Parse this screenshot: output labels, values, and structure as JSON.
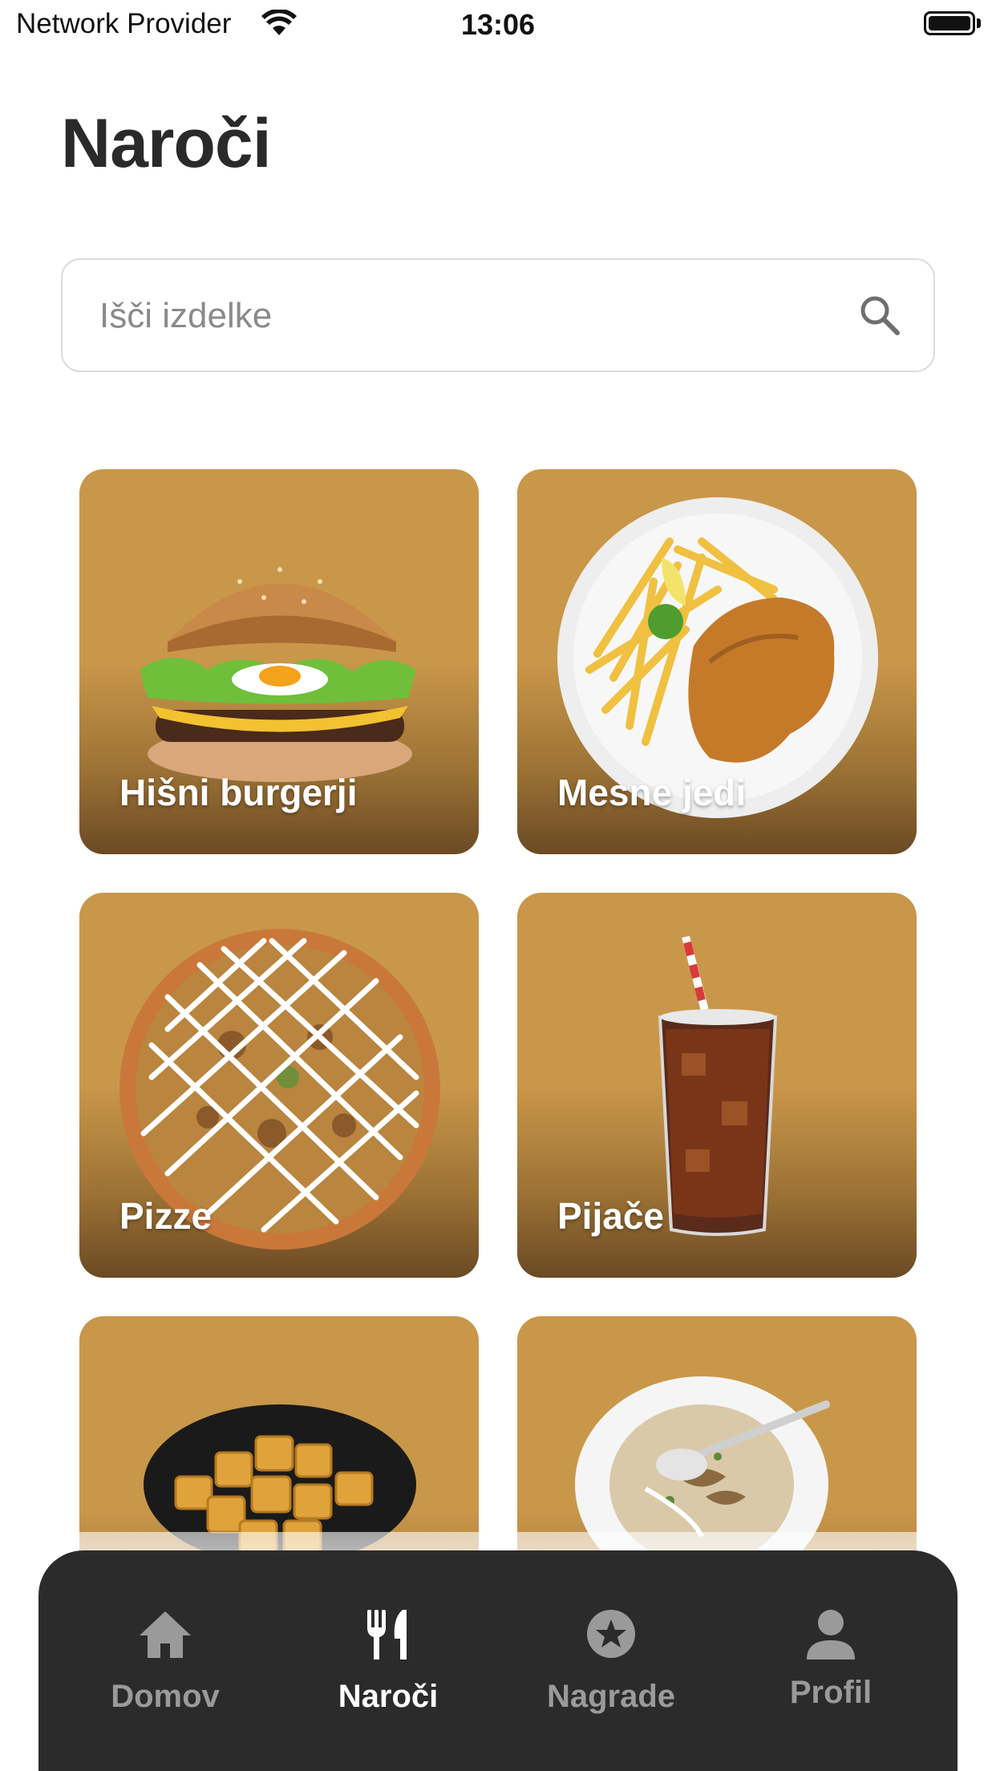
{
  "status_bar": {
    "carrier": "Network Provider",
    "time": "13:06"
  },
  "page": {
    "title": "Naroči"
  },
  "search": {
    "placeholder": "Išči izdelke",
    "value": ""
  },
  "categories": [
    {
      "label": "Hišni burgerji",
      "icon": "burger-image"
    },
    {
      "label": "Mesne jedi",
      "icon": "schnitzel-fries-image"
    },
    {
      "label": "Pizze",
      "icon": "pizza-image"
    },
    {
      "label": "Pijače",
      "icon": "cola-glass-image"
    },
    {
      "label": "",
      "icon": "potatoes-bowl-image"
    },
    {
      "label": "",
      "icon": "mushroom-soup-image"
    }
  ],
  "tabbar": {
    "items": [
      {
        "label": "Domov",
        "icon": "home-icon",
        "active": false
      },
      {
        "label": "Naroči",
        "icon": "fork-knife-icon",
        "active": true
      },
      {
        "label": "Nagrade",
        "icon": "star-badge-icon",
        "active": false
      },
      {
        "label": "Profil",
        "icon": "person-icon",
        "active": false
      }
    ]
  },
  "colors": {
    "card_bg": "#c9974a",
    "tabbar_bg": "#2b2b2b",
    "text_dark": "#2a2a2a"
  }
}
